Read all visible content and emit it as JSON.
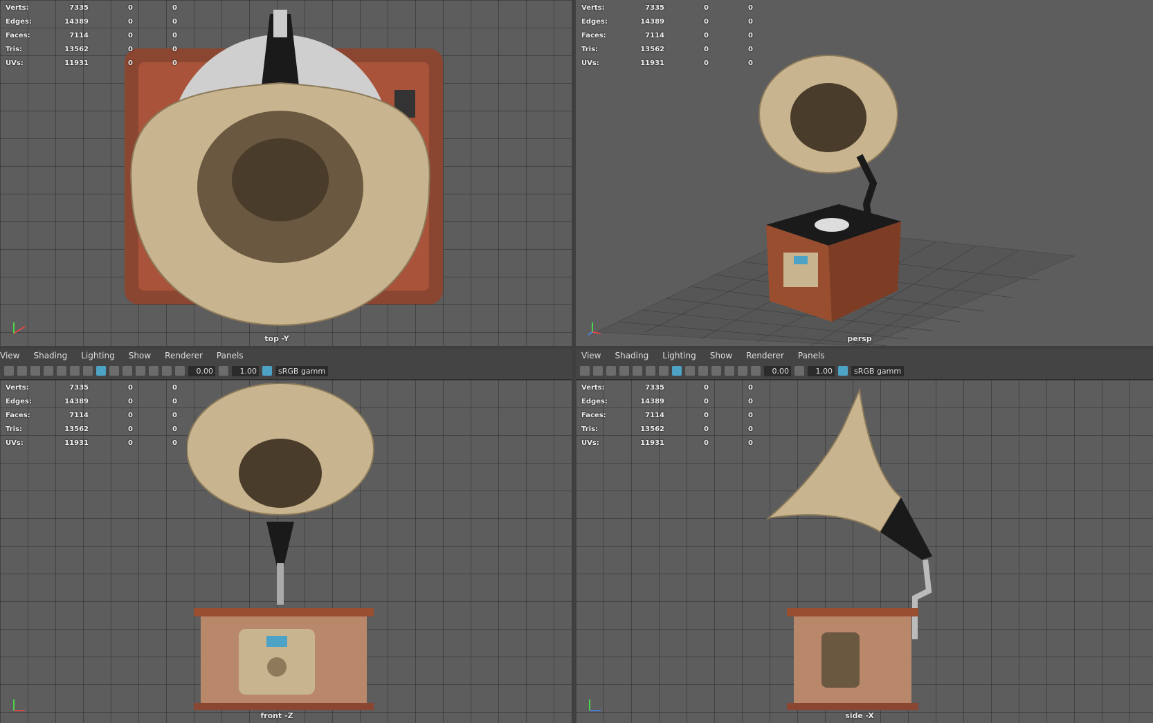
{
  "menus": [
    "View",
    "Shading",
    "Lighting",
    "Show",
    "Renderer",
    "Panels"
  ],
  "toolbar": {
    "field1": "0.00",
    "field2": "1.00",
    "gamma": "sRGB gamm"
  },
  "hud": {
    "rows": [
      {
        "label": "Verts:",
        "v1": "7335",
        "v2": "0",
        "v3": "0"
      },
      {
        "label": "Edges:",
        "v1": "14389",
        "v2": "0",
        "v3": "0"
      },
      {
        "label": "Faces:",
        "v1": "7114",
        "v2": "0",
        "v3": "0"
      },
      {
        "label": "Tris:",
        "v1": "13562",
        "v2": "0",
        "v3": "0"
      },
      {
        "label": "UVs:",
        "v1": "11931",
        "v2": "0",
        "v3": "0"
      }
    ]
  },
  "viewports": {
    "top": {
      "camera": "top -Y"
    },
    "persp": {
      "camera": "persp"
    },
    "front": {
      "camera": "front -Z"
    },
    "side": {
      "camera": "side -X"
    }
  },
  "colors": {
    "viewport_bg": "#5d5d5d",
    "wood": "#a8533a",
    "brass": "#c8b48e",
    "accent": "#4da3c6"
  }
}
